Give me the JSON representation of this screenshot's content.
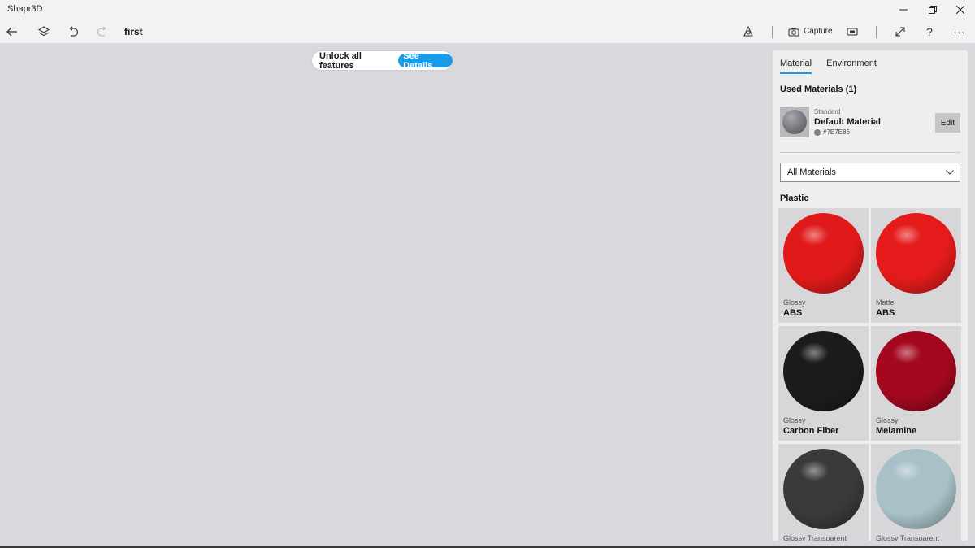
{
  "app": {
    "title": "Shapr3D"
  },
  "toolbar": {
    "doc_title": "first",
    "capture_label": "Capture"
  },
  "promo": {
    "text": "Unlock all features",
    "button_label": "See Details"
  },
  "panel": {
    "tabs": [
      {
        "label": "Material",
        "active": true
      },
      {
        "label": "Environment",
        "active": false
      }
    ],
    "used_title": "Used Materials (1)",
    "used_material": {
      "category": "Standard",
      "name": "Default Material",
      "hex": "#7E7E86",
      "edit_label": "Edit"
    },
    "filter": {
      "selected": "All Materials"
    },
    "group_title": "Plastic",
    "materials": [
      {
        "category": "Glossy",
        "name": "ABS",
        "color": "#e01a1a"
      },
      {
        "category": "Matte",
        "name": "ABS",
        "color": "#e51b1b"
      },
      {
        "category": "Glossy",
        "name": "Carbon Fiber",
        "color": "#1c1c1c"
      },
      {
        "category": "Glossy",
        "name": "Melamine",
        "color": "#a3081f"
      },
      {
        "category": "Glossy Transparent",
        "name": "",
        "color": "#3a3a3a"
      },
      {
        "category": "Glossy Transparent",
        "name": "",
        "color": "#a8c1c8"
      }
    ]
  },
  "colors": {
    "accent": "#1a9be8",
    "canvas": "#d9d8dd"
  }
}
